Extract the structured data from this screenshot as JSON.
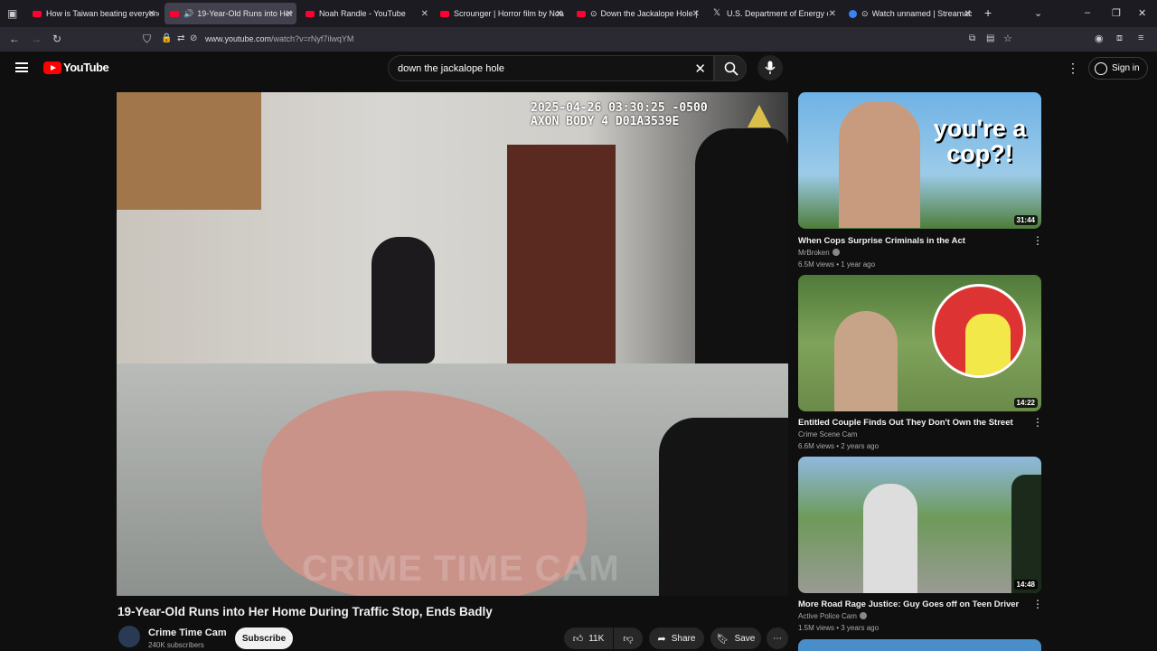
{
  "browser": {
    "tabs": [
      {
        "title": "How is Taiwan beating everyone",
        "favicon": "youtube-icon"
      },
      {
        "title": "19-Year-Old Runs into Her",
        "favicon": "youtube-icon",
        "active": true
      },
      {
        "title": "Noah Randle - YouTube",
        "favicon": "youtube-icon"
      },
      {
        "title": "Scrounger | Horror film by Noah",
        "favicon": "youtube-icon"
      },
      {
        "title": "Down the Jackalope Hole |",
        "favicon": "youtube-icon"
      },
      {
        "title": "U.S. Department of Energy on X",
        "favicon": "x-icon"
      },
      {
        "title": "Watch unnamed | Streamab",
        "favicon": "streamable-icon"
      }
    ],
    "url_domain": "www.youtube.com",
    "url_path": "/watch?v=rNyf7ilwqYM"
  },
  "header": {
    "logo_text": "YouTube",
    "search_query": "down the jackalope hole",
    "sign_in_label": "Sign in"
  },
  "video": {
    "timestamp_line1": "2025-04-26 03:30:25 -0500",
    "timestamp_line2": "AXON BODY 4 D01A3539E",
    "watermark": "CRIME TIME CAM",
    "title": "19-Year-Old Runs into Her Home During Traffic Stop, Ends Badly",
    "channel_name": "Crime Time Cam",
    "channel_subs": "240K subscribers",
    "subscribe_label": "Subscribe",
    "like_count": "11K",
    "share_label": "Share",
    "save_label": "Save"
  },
  "recommendations": [
    {
      "title": "When Cops Surprise Criminals in the Act",
      "channel": "MrBroken",
      "verified": true,
      "meta": "6.5M views • 1 year ago",
      "duration": "31:44",
      "thumb_text": "you're a cop?!"
    },
    {
      "title": "Entitled Couple Finds Out They Don't Own the Street",
      "channel": "Crime Scene Cam",
      "verified": false,
      "meta": "6.6M views • 2 years ago",
      "duration": "14:22"
    },
    {
      "title": "More Road Rage Justice: Guy Goes off on Teen Driver",
      "channel": "Active Police Cam",
      "verified": true,
      "meta": "1.5M views • 3 years ago",
      "duration": "14:48"
    }
  ]
}
